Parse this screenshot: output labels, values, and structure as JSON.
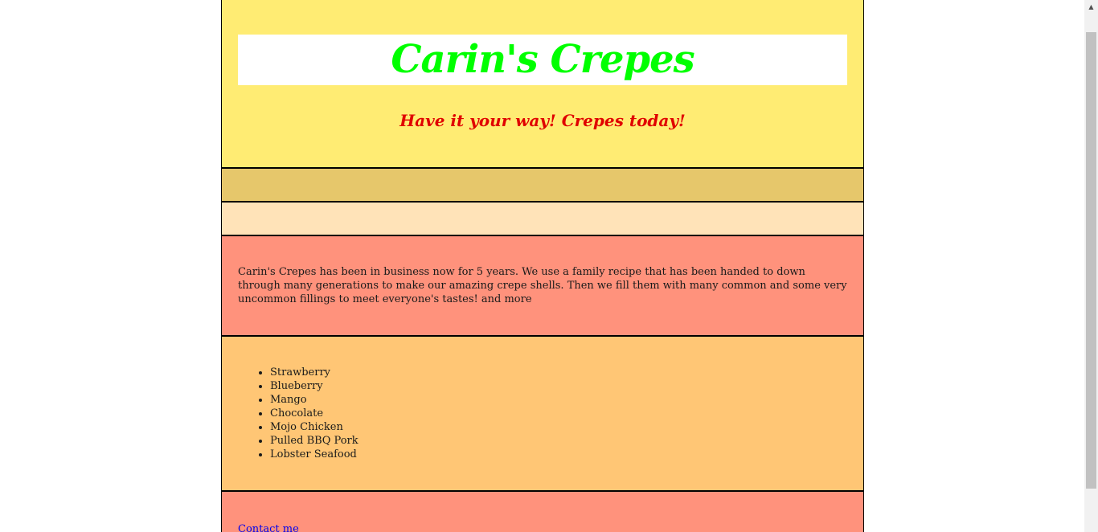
{
  "header": {
    "title": "Carin's Crepes",
    "tagline": "Have it your way! Crepes today!"
  },
  "about": {
    "text": "Carin's Crepes has been in business now for 5 years. We use a family recipe that has been handed to down through many generations to make our amazing crepe shells. Then we fill them with many common and some very uncommon fillings to meet everyone's tastes! and more"
  },
  "fillings": {
    "items": [
      "Strawberry",
      "Blueberry",
      "Mango",
      "Chocolate",
      "Mojo Chicken",
      "Pulled BBQ Pork",
      "Lobster Seafood"
    ]
  },
  "footer": {
    "contact_label": "Contact me"
  },
  "colors": {
    "header_bg": "#ffec73",
    "title": "#00ff00",
    "tagline": "#e00000",
    "nav_bg": "#e6c76b",
    "sub_bg": "#ffe3b8",
    "about_bg": "#ff927c",
    "fillings_bg": "#ffc675",
    "link": "#0000ee"
  },
  "icons": {
    "scroll_up": "scroll-up-arrow-icon"
  }
}
